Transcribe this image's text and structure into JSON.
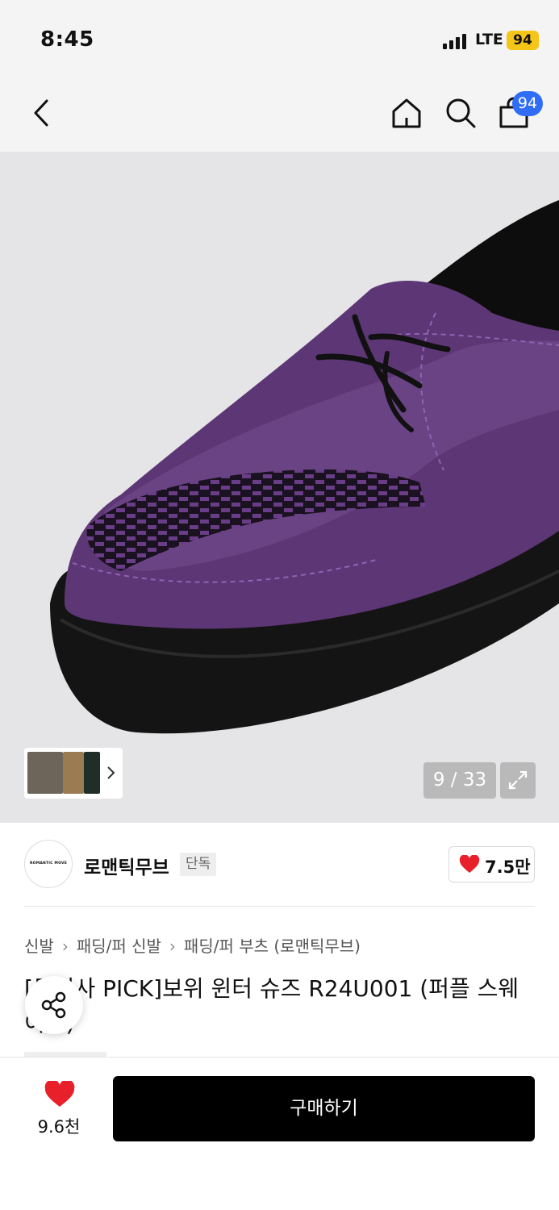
{
  "status_bar": {
    "time": "8:45",
    "network": "LTE",
    "battery": "94"
  },
  "nav": {
    "cart_count": "94",
    "icons": [
      "back-arrow-icon",
      "home-icon",
      "search-icon",
      "shopping-bag-icon"
    ]
  },
  "gallery": {
    "counter": "9 / 33",
    "image_subject": "purple suede creeper shoe with fur lining"
  },
  "brand": {
    "logo_text": "ROMANTIC MOVE",
    "name": "로맨틱무브",
    "badge": "단독",
    "likes": "7.5만"
  },
  "breadcrumb": [
    "신발",
    "패딩/퍼 신발",
    "패딩/퍼 부츠 (로맨틱무브)"
  ],
  "product": {
    "title": "[무신사 PICK]보위 윈터 슈즈 R24U001 (퍼플 스웨이드)"
  },
  "bottom_bar": {
    "wish_count": "9.6천",
    "buy_label": "구매하기"
  },
  "colors": {
    "accent_blue": "#2f6df6",
    "heart_red": "#e8202a",
    "battery_yellow": "#f5c518",
    "buy_black": "#000000"
  }
}
